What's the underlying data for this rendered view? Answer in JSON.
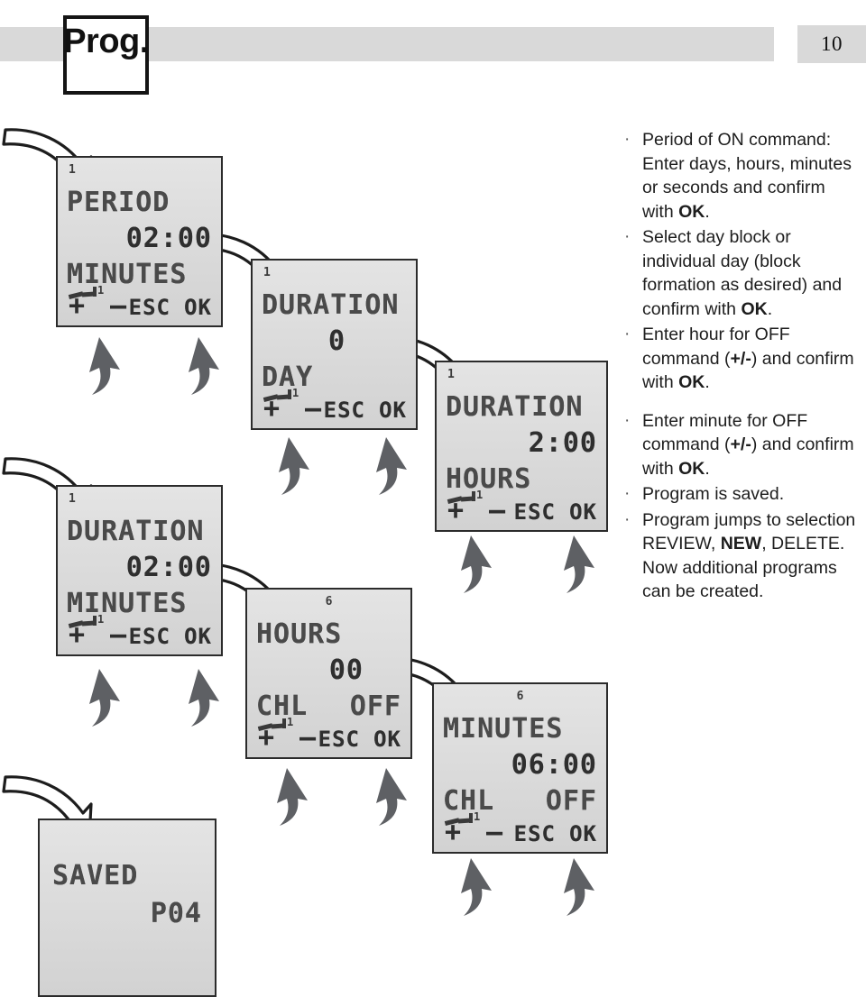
{
  "header": {
    "prog_label": "Prog.",
    "page_number": "10"
  },
  "panels": [
    {
      "id": "period-minutes",
      "channel": "1",
      "channel_align": "left",
      "title": "PERIOD",
      "value": "02:00",
      "unit": "MINUTES",
      "unit_right": "",
      "relay_sup": "1",
      "softkeys": {
        "plus": "+",
        "minus": "–",
        "esc": "ESC",
        "ok": "OK"
      }
    },
    {
      "id": "duration-day",
      "channel": "1",
      "channel_align": "left",
      "title": "DURATION",
      "value": "0",
      "unit": "DAY",
      "unit_right": "",
      "relay_sup": "1",
      "softkeys": {
        "plus": "+",
        "minus": "–",
        "esc": "ESC",
        "ok": "OK"
      }
    },
    {
      "id": "duration-hours",
      "channel": "1",
      "channel_align": "left",
      "title": "DURATION",
      "value": "2:00",
      "unit": "HOURS",
      "unit_right": "",
      "relay_sup": "1",
      "softkeys": {
        "plus": "+",
        "minus": "–",
        "esc": "ESC",
        "ok": "OK"
      }
    },
    {
      "id": "duration-minutes",
      "channel": "1",
      "channel_align": "left",
      "title": "DURATION",
      "value": "02:00",
      "unit": "MINUTES",
      "unit_right": "",
      "relay_sup": "1",
      "softkeys": {
        "plus": "+",
        "minus": "–",
        "esc": "ESC",
        "ok": "OK"
      }
    },
    {
      "id": "hours-chl-off",
      "channel": "6",
      "channel_align": "center",
      "title": "HOURS",
      "value": "00",
      "unit": "CHL",
      "unit_right": "OFF",
      "relay_sup": "1",
      "softkeys": {
        "plus": "+",
        "minus": "–",
        "esc": "ESC",
        "ok": "OK"
      }
    },
    {
      "id": "minutes-chl-off",
      "channel": "6",
      "channel_align": "center",
      "title": "MINUTES",
      "value": "06:00",
      "unit": "CHL",
      "unit_right": "OFF",
      "relay_sup": "1",
      "softkeys": {
        "plus": "+",
        "minus": "–",
        "esc": "ESC",
        "ok": "OK"
      }
    },
    {
      "id": "saved",
      "channel": "",
      "channel_align": "left",
      "title": "SAVED",
      "value": "P04",
      "unit": "",
      "unit_right": "",
      "relay_sup": "",
      "softkeys": {
        "plus": "",
        "minus": "",
        "esc": "",
        "ok": ""
      }
    }
  ],
  "instructions": [
    {
      "parts": [
        {
          "t": "Period of ON command: Enter days, hours, minutes or seconds and confirm with ",
          "b": false
        },
        {
          "t": "OK",
          "b": true
        },
        {
          "t": ".",
          "b": false
        }
      ]
    },
    {
      "parts": [
        {
          "t": "Select day block or individual day (block formation as desired) and confirm with ",
          "b": false
        },
        {
          "t": "OK",
          "b": true
        },
        {
          "t": ".",
          "b": false
        }
      ]
    },
    {
      "parts": [
        {
          "t": "Enter hour for OFF command (",
          "b": false
        },
        {
          "t": "+/-",
          "b": true
        },
        {
          "t": ") and confirm with ",
          "b": false
        },
        {
          "t": "OK",
          "b": true
        },
        {
          "t": ".",
          "b": false
        }
      ]
    },
    {
      "parts": [
        {
          "t": "Enter minute for OFF command (",
          "b": false
        },
        {
          "t": "+/-",
          "b": true
        },
        {
          "t": ") and confirm with ",
          "b": false
        },
        {
          "t": "OK",
          "b": true
        },
        {
          "t": ".",
          "b": false
        }
      ],
      "gap_before": true
    },
    {
      "parts": [
        {
          "t": "Program is saved.",
          "b": false
        }
      ]
    },
    {
      "parts": [
        {
          "t": "Program jumps to selection REVIEW, ",
          "b": false
        },
        {
          "t": "NEW",
          "b": true
        },
        {
          "t": ", DELETE. Now additional programs can be created.",
          "b": false
        }
      ]
    }
  ],
  "colors": {
    "header_band": "#d9d9d9",
    "lcd_bg": "#dcdcdc",
    "lcd_border": "#2b2b2b",
    "seg_text": "#4a4a4a",
    "gray_arrow": "#5e6064",
    "text": "#1d1d1d"
  },
  "icons": {
    "relay_contact": "relay-contact-icon",
    "white_flow_arrow": "flow-arrow-icon",
    "gray_press_arrow": "press-arrow-icon"
  }
}
